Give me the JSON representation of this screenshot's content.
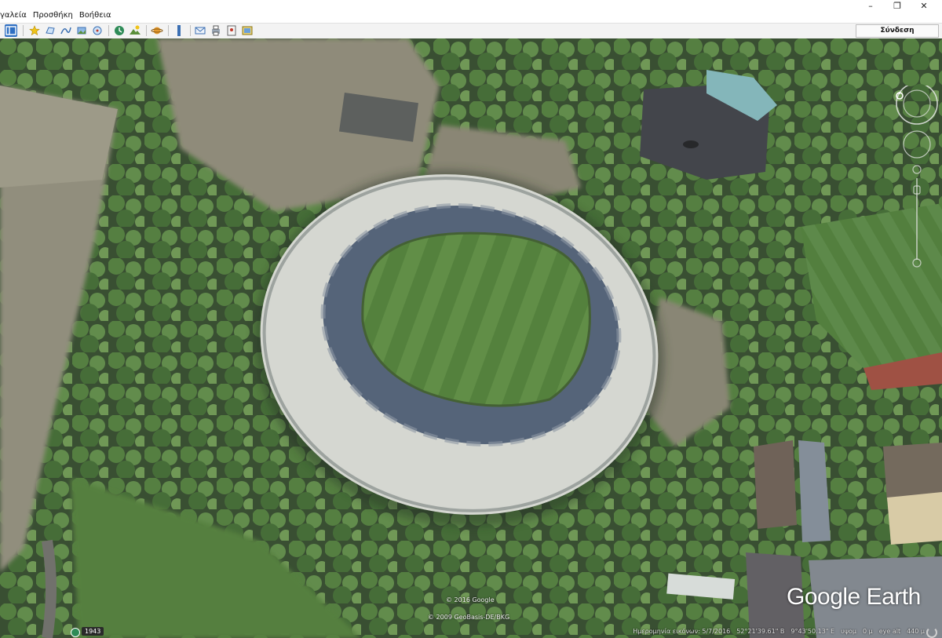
{
  "menu": {
    "items": [
      "γαλεία",
      "Προσθήκη",
      "Βοήθεια"
    ]
  },
  "window_controls": {
    "minimize": "–",
    "restore": "❐",
    "close": "✕"
  },
  "toolbar": {
    "signin_label": "Σύνδεση",
    "buttons": [
      "sidebar",
      "placemark",
      "polygon",
      "path",
      "image-overlay",
      "tour",
      "history",
      "sun",
      "planets",
      "ruler",
      "email",
      "print",
      "maps",
      "save-image"
    ]
  },
  "map": {
    "copyright_google": "© 2016 Google",
    "copyright_geobasis": "© 2009 GeoBasis-DE/BKG",
    "logo_text": "Google Earth"
  },
  "status": {
    "year_label": "1943",
    "imagery_date": "Ημερομηνία εικόνων: 5/7/2016",
    "latitude": "52°21'39.61\" Β",
    "longitude": "9°43'50.13\" Ε",
    "elevation": "υψομ",
    "elevation_value": "0 μ",
    "eye_alt_label": "eye alt",
    "eye_alt_value": "440 μ"
  },
  "colors": {
    "accent": "#2f6fc2",
    "grass": "#4e7c36",
    "stand_grey": "#cfd2cd",
    "seats_blue": "#4f5e74"
  }
}
